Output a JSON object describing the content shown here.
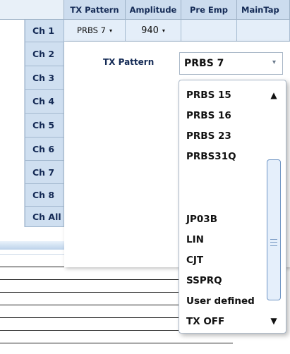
{
  "grid": {
    "headers": [
      "TX Pattern",
      "Amplitude",
      "Pre Emp",
      "MainTap"
    ],
    "channels": [
      "Ch 1",
      "Ch 2",
      "Ch 3",
      "Ch 4",
      "Ch 5",
      "Ch 6",
      "Ch 7",
      "Ch 8",
      "Ch All"
    ],
    "ch1_row": {
      "tx_pattern": "PRBS 7",
      "amplitude": "940",
      "pre_emp": "",
      "main_tap": ""
    }
  },
  "editor": {
    "label": "TX Pattern",
    "selected": "PRBS 7"
  },
  "dropdown": {
    "options_top": [
      "PRBS 15",
      "PRBS 16",
      "PRBS 23",
      "PRBS31Q"
    ],
    "options_bottom": [
      "JP03B",
      "LIN",
      "CJT",
      "SSPRQ",
      "User defined",
      "TX OFF"
    ]
  },
  "icons": {
    "caret": "▾",
    "scroll_up": "▲",
    "scroll_down": "▼"
  },
  "colors": {
    "header_bg": "#ccdcee",
    "row_header_bg": "#cfdff0",
    "text_dark": "#142a55",
    "scroll_thumb_border": "#6f95c4"
  }
}
